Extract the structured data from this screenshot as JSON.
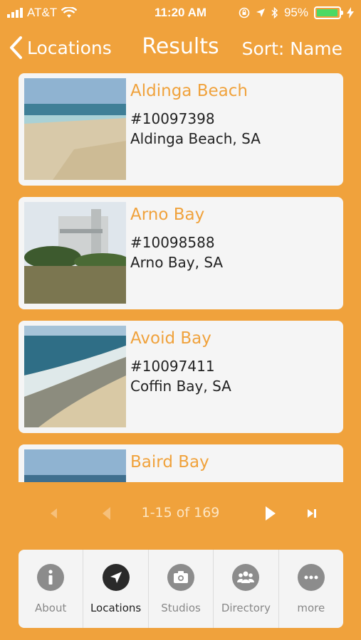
{
  "status_bar": {
    "carrier": "AT&T",
    "time": "11:20 AM",
    "battery": "95%",
    "battery_level": 0.95
  },
  "nav": {
    "back_label": "Locations",
    "title": "Results",
    "sort_label": "Sort: Name"
  },
  "results": [
    {
      "title": "Aldinga Beach",
      "code": "#10097398",
      "place": "Aldinga Beach, SA"
    },
    {
      "title": "Arno Bay",
      "code": "#10098588",
      "place": "Arno Bay, SA"
    },
    {
      "title": "Avoid Bay",
      "code": "#10097411",
      "place": "Coffin Bay, SA"
    },
    {
      "title": "Baird Bay",
      "code": "",
      "place": ""
    }
  ],
  "pagination": {
    "range": "1-15 of 169"
  },
  "tabs": [
    {
      "label": "About",
      "icon": "info-icon",
      "active": false
    },
    {
      "label": "Locations",
      "icon": "location-arrow-icon",
      "active": true
    },
    {
      "label": "Studios",
      "icon": "camera-icon",
      "active": false
    },
    {
      "label": "Directory",
      "icon": "people-icon",
      "active": false
    },
    {
      "label": "more",
      "icon": "more-icon",
      "active": false
    }
  ],
  "colors": {
    "background": "#f0a23c",
    "accent_title": "#f0a23c",
    "card": "#f5f5f5",
    "battery": "#4cd964"
  }
}
